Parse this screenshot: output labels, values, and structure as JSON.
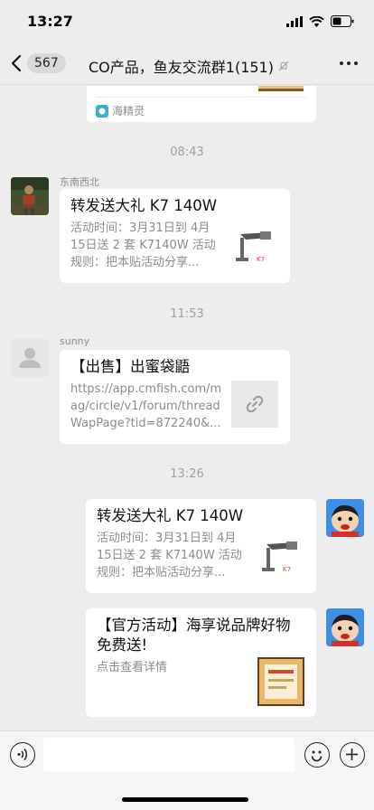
{
  "status_bar": {
    "time": "13:27"
  },
  "nav": {
    "unread_count": "567",
    "title": "CO产品，鱼友交流群1(151)"
  },
  "messages": [
    {
      "type": "card_tail",
      "source_label": "海精灵"
    },
    {
      "type": "timestamp",
      "text": "08:43"
    },
    {
      "type": "card",
      "side": "left",
      "sender": "东南西北",
      "title": "转发送大礼 K7 140W",
      "desc_lines": [
        "活动时间：3月31日到 4月",
        "15日送 2 套 K7140W 活动",
        "规则：把本贴活动分享..."
      ]
    },
    {
      "type": "timestamp",
      "text": "11:53"
    },
    {
      "type": "link",
      "side": "left",
      "sender": "sunny",
      "title": "【出售】出蜜袋鼯",
      "desc_lines": [
        "https://app.cmfish.com/m",
        "ag/circle/v1/forum/thread",
        "WapPage?tid=872240&..."
      ]
    },
    {
      "type": "timestamp",
      "text": "13:26"
    },
    {
      "type": "card",
      "side": "right",
      "title": "转发送大礼 K7 140W",
      "desc_lines": [
        "活动时间：3月31日到 4月",
        "15日送 2 套 K7140W 活动",
        "规则：把本贴活动分享..."
      ]
    },
    {
      "type": "card",
      "side": "right",
      "title_lines": [
        "【官方活动】海享说品牌好物",
        "免费送!"
      ],
      "desc_lines": [
        "点击查看详情"
      ]
    }
  ],
  "colors": {
    "background": "#ededed",
    "bubble": "#ffffff",
    "secondary_text": "#8c8c8c"
  },
  "icons": [
    "back-icon",
    "mute-icon",
    "more-icon",
    "voice-icon",
    "emoji-icon",
    "add-icon",
    "link-icon"
  ]
}
